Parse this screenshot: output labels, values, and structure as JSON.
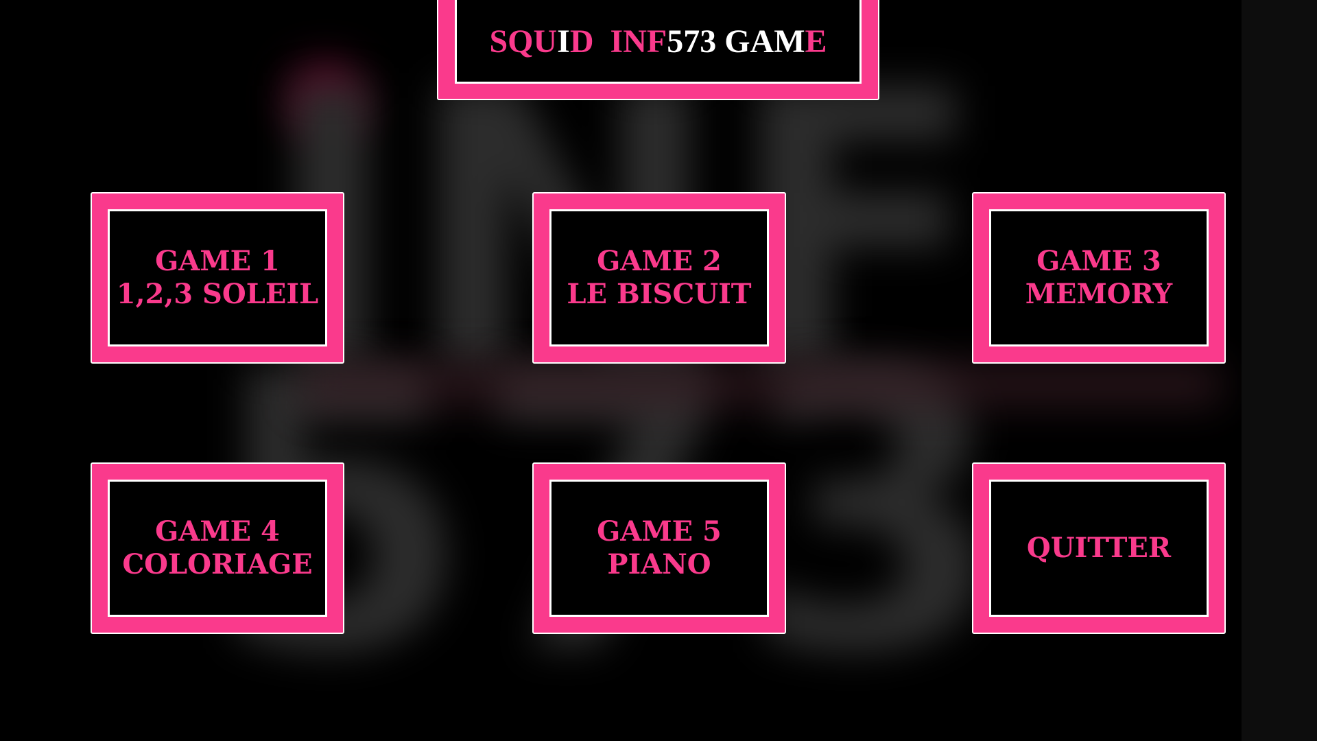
{
  "title": {
    "parts": [
      {
        "text": "SQU",
        "color": "#fa3a8c"
      },
      {
        "text": "I",
        "color": "#ffffff"
      },
      {
        "text": "D  INF",
        "color": "#fa3a8c"
      },
      {
        "text": "573 GAM",
        "color": "#ffffff"
      },
      {
        "text": "E",
        "color": "#fa3a8c"
      }
    ]
  },
  "colors": {
    "accent": "#fa3a8c",
    "border": "#ffffff",
    "background": "#000000"
  },
  "menu": {
    "items": [
      {
        "line1": "GAME 1",
        "line2": "1,2,3 SOLEIL"
      },
      {
        "line1": "GAME 2",
        "line2": "LE BISCUIT"
      },
      {
        "line1": "GAME 3",
        "line2": "MEMORY"
      },
      {
        "line1": "GAME 4",
        "line2": "COLORIAGE"
      },
      {
        "line1": "GAME 5",
        "line2": "PIANO"
      },
      {
        "line1": "QUITTER"
      }
    ]
  }
}
